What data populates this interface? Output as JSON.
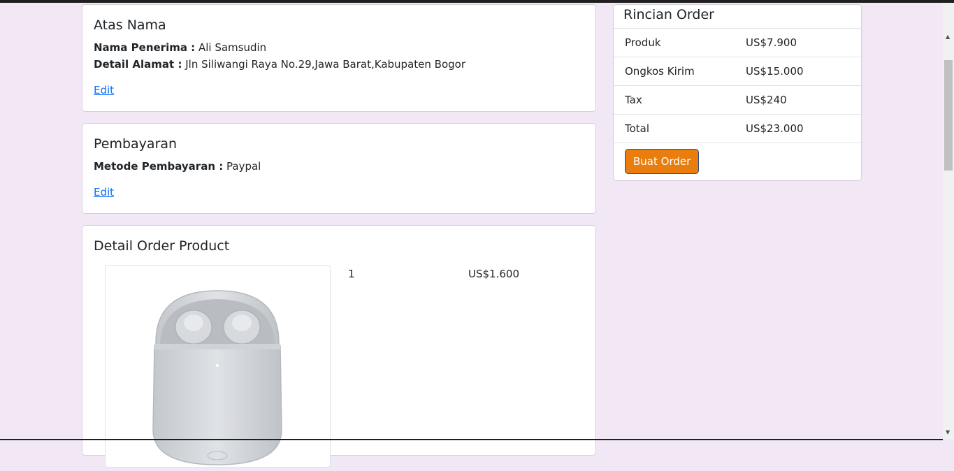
{
  "atas_nama": {
    "title": "Atas Nama",
    "penerima_label": "Nama Penerima :",
    "penerima_value": "Ali Samsudin",
    "alamat_label": "Detail Alamat :",
    "alamat_value": "Jln Siliwangi Raya No.29,Jawa Barat,Kabupaten Bogor",
    "edit": "Edit"
  },
  "pembayaran": {
    "title": "Pembayaran",
    "metode_label": "Metode Pembayaran :",
    "metode_value": "Paypal",
    "edit": "Edit"
  },
  "detail_order": {
    "title": "Detail Order Product",
    "product": {
      "image": "earbuds-case",
      "qty": "1",
      "price": "US$1.600"
    }
  },
  "rincian": {
    "title": "Rincian Order",
    "rows": [
      {
        "label": "Produk",
        "value": "US$7.900"
      },
      {
        "label": "Ongkos Kirim",
        "value": "US$15.000"
      },
      {
        "label": "Tax",
        "value": "US$240"
      },
      {
        "label": "Total",
        "value": "US$23.000"
      }
    ],
    "button": "Buat Order"
  },
  "colors": {
    "background": "#f2e8f5",
    "button": "#e97d0e",
    "link": "#0d6efd"
  }
}
